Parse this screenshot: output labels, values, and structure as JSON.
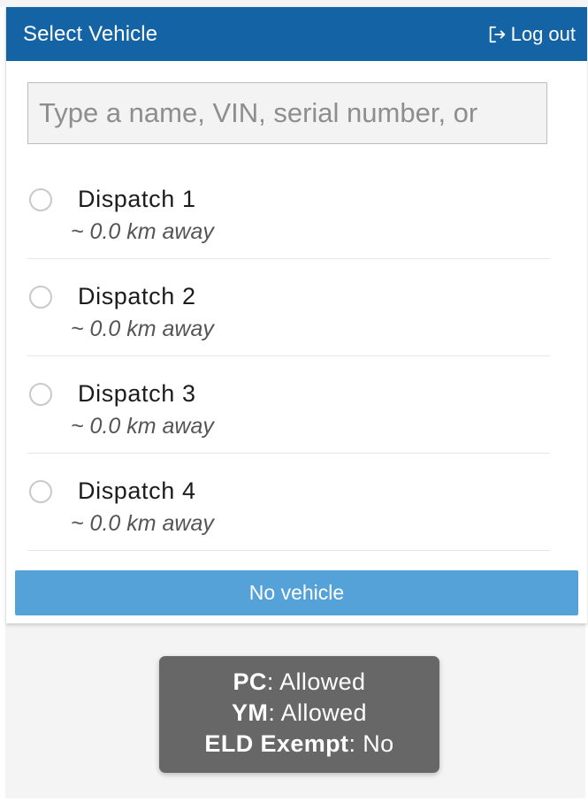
{
  "header": {
    "title": "Select Vehicle",
    "logout_label": "Log out",
    "color": "#1464a5"
  },
  "search": {
    "placeholder": "Type a name, VIN, serial number, or",
    "value": ""
  },
  "vehicles": [
    {
      "name": "Dispatch 1",
      "distance": "~ 0.0 km away",
      "selected": false
    },
    {
      "name": "Dispatch 2",
      "distance": "~ 0.0 km away",
      "selected": false
    },
    {
      "name": "Dispatch 3",
      "distance": "~ 0.0 km away",
      "selected": false
    },
    {
      "name": "Dispatch 4",
      "distance": "~ 0.0 km away",
      "selected": false
    }
  ],
  "no_vehicle_button": {
    "label": "No vehicle",
    "color": "#55a2d9"
  },
  "status": {
    "pc_label": "PC",
    "pc_value": ": Allowed",
    "ym_label": "YM",
    "ym_value": ": Allowed",
    "eld_label": "ELD Exempt",
    "eld_value": ": No"
  },
  "icons": {
    "logout": "logout-icon",
    "radio": "radio-unchecked-icon"
  }
}
